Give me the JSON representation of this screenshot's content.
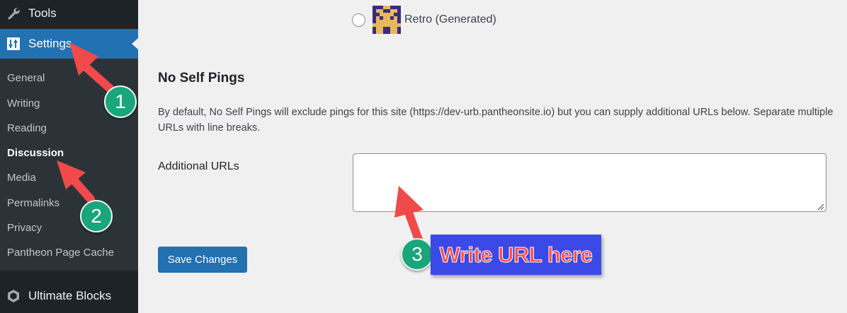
{
  "sidebar": {
    "tools_label": "Tools",
    "settings_label": "Settings",
    "submenu": [
      {
        "label": "General"
      },
      {
        "label": "Writing"
      },
      {
        "label": "Reading"
      },
      {
        "label": "Discussion",
        "current": true
      },
      {
        "label": "Media"
      },
      {
        "label": "Permalinks"
      },
      {
        "label": "Privacy"
      },
      {
        "label": "Pantheon Page Cache"
      }
    ],
    "ultimate_blocks_label": "Ultimate Blocks"
  },
  "avatar_option": {
    "label": "Retro (Generated)"
  },
  "section": {
    "title": "No Self Pings",
    "description": "By default, No Self Pings will exclude pings for this site (https://dev-urb.pantheonsite.io) but you can supply additional URLs below. Separate multiple URLs with line breaks.",
    "field_label": "Additional URLs",
    "field_value": ""
  },
  "save_button_label": "Save Changes",
  "annotations": {
    "badges": [
      "1",
      "2",
      "3"
    ],
    "callout_text": "Write URL here",
    "arrow_color": "#f04a4a",
    "badge_color": "#1aa57a",
    "callout_bg": "#3b49e6"
  },
  "colors": {
    "sidebar_bg": "#1d2327",
    "submenu_bg": "#2c3338",
    "accent": "#2271b1",
    "page_bg": "#f0f0f1"
  }
}
